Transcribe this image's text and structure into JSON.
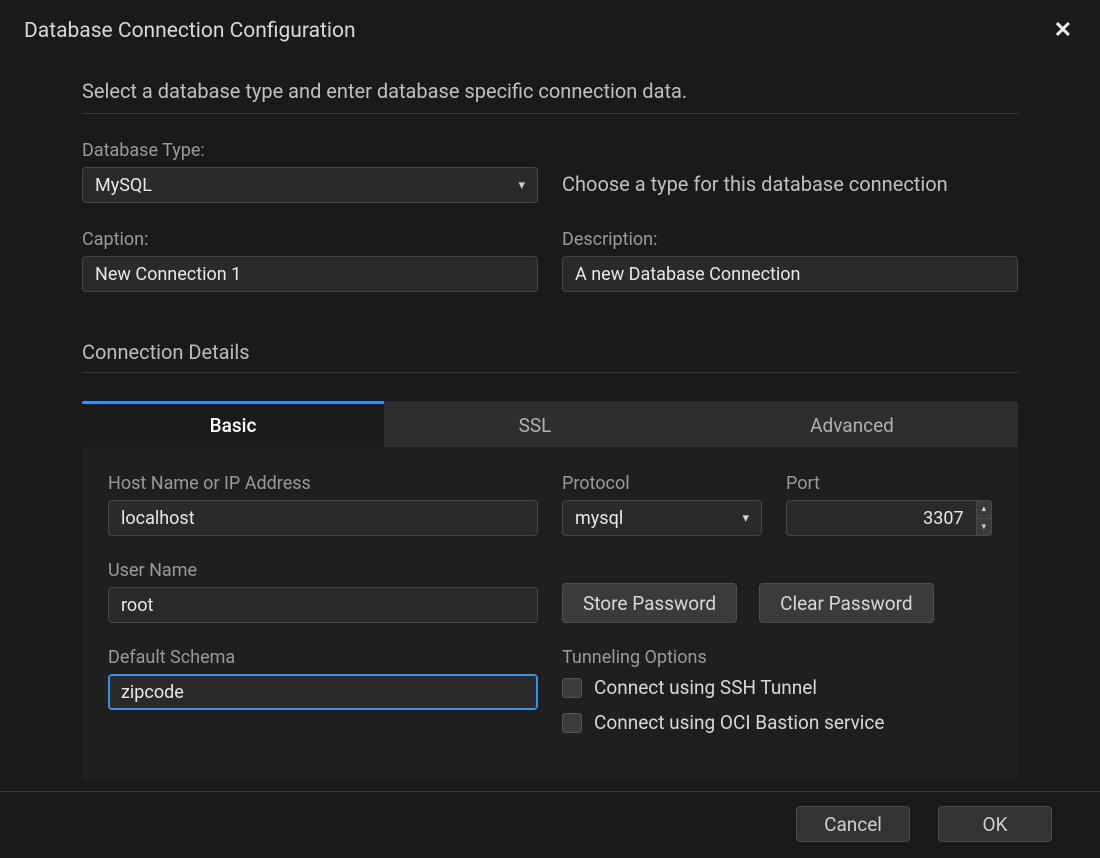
{
  "dialog": {
    "title": "Database Connection Configuration",
    "intro": "Select a database type and enter database specific connection data.",
    "dbtype_label": "Database Type:",
    "dbtype_value": "MySQL",
    "dbtype_helper": "Choose a type for this database connection",
    "caption_label": "Caption:",
    "caption_value": "New Connection 1",
    "description_label": "Description:",
    "description_value": "A new Database Connection",
    "conn_details_title": "Connection Details",
    "tabs": {
      "basic": "Basic",
      "ssl": "SSL",
      "advanced": "Advanced"
    },
    "basic": {
      "host_label": "Host Name or IP Address",
      "host_value": "localhost",
      "protocol_label": "Protocol",
      "protocol_value": "mysql",
      "port_label": "Port",
      "port_value": "3307",
      "username_label": "User Name",
      "username_value": "root",
      "store_pw": "Store Password",
      "clear_pw": "Clear Password",
      "schema_label": "Default Schema",
      "schema_value": "zipcode",
      "tunnel_label": "Tunneling Options",
      "tunnel_ssh": "Connect using SSH Tunnel",
      "tunnel_oci": "Connect using OCI Bastion service"
    },
    "footer": {
      "cancel": "Cancel",
      "ok": "OK"
    }
  }
}
